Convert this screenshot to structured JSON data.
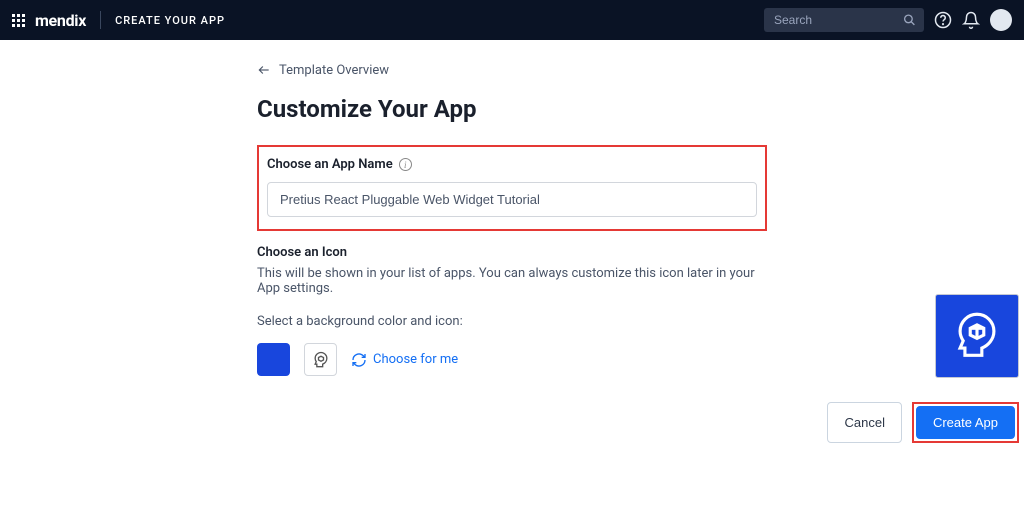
{
  "topbar": {
    "brand": "mendix",
    "subtitle": "CREATE YOUR APP",
    "search_placeholder": "Search"
  },
  "back": {
    "label": "Template Overview"
  },
  "page_title": "Customize Your App",
  "app_name": {
    "label": "Choose an App Name",
    "value": "Pretius React Pluggable Web Widget Tutorial"
  },
  "icon_section": {
    "label": "Choose an Icon",
    "description": "This will be shown in your list of apps. You can always customize this icon later in your App settings.",
    "select_text": "Select a background color and icon:",
    "choose_for_me": "Choose for me",
    "color": "#1846dd"
  },
  "actions": {
    "cancel": "Cancel",
    "create": "Create App"
  }
}
